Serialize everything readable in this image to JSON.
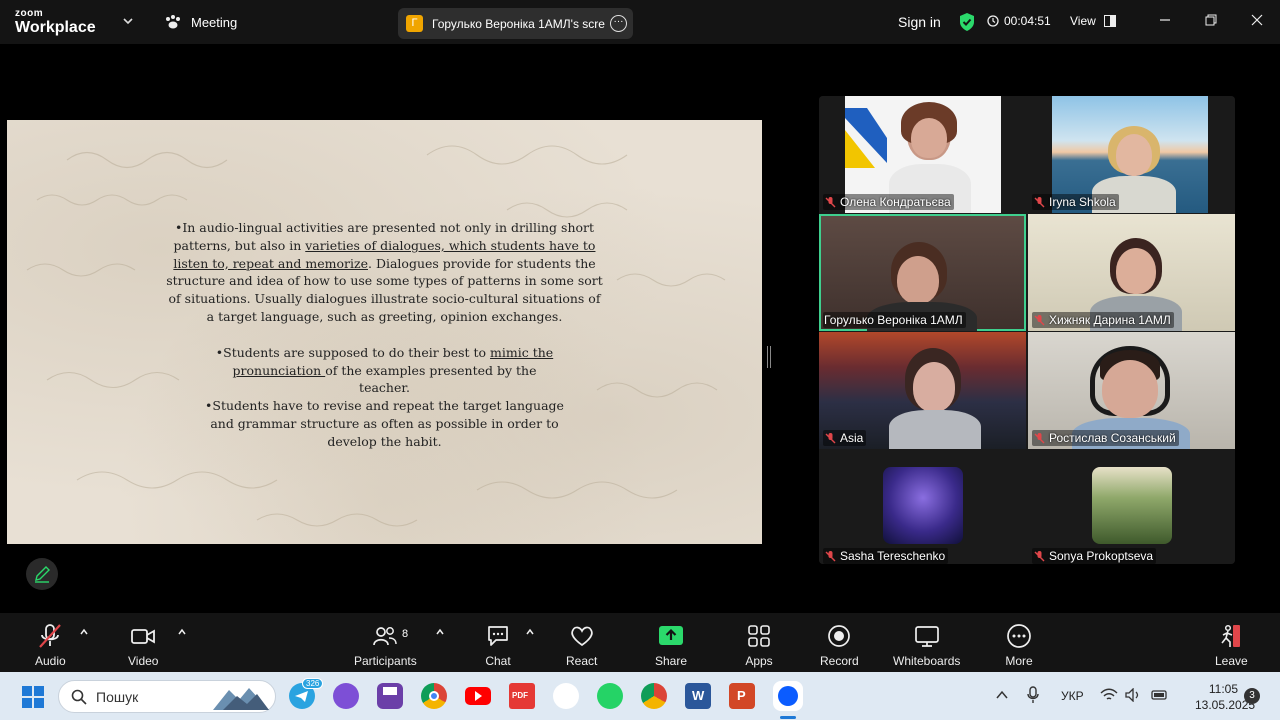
{
  "titlebar": {
    "logo_top": "zoom",
    "logo_bottom": "Workplace",
    "meeting_label": "Meeting",
    "share_initial": "Г",
    "share_title": "Горулько Вероніка 1АМЛ's scre",
    "signin_label": "Sign in",
    "timer": "00:04:51",
    "view_label": "View"
  },
  "slide": {
    "p1_a": "•In audio-lingual activities are presented not only in drilling short patterns, but also in ",
    "p1_u": "varieties of dialogues, which students have to listen to, repeat and memorize",
    "p1_b": ". Dialogues provide for students the structure and idea of how to use some types of patterns in some sort of situations. Usually dialogues illustrate socio-cultural situations of a target language, such as greeting, opinion exchanges.",
    "p2_a": "•Students are supposed to do their best to ",
    "p2_u": "mimic the pronunciation ",
    "p2_b": "of the examples presented by the teacher.",
    "p3": "•Students have to revise and repeat the target language and grammar structure as often as possible in order to develop the habit."
  },
  "participants": [
    {
      "name": "Олена  Кондратьєва"
    },
    {
      "name": "Iryna Shkola"
    },
    {
      "name": "Горулько Вероніка 1АМЛ"
    },
    {
      "name": "Хижняк Дарина 1АМЛ"
    },
    {
      "name": "Asia"
    },
    {
      "name": "Ростислав Созанський"
    },
    {
      "name": "Sasha Tereschenko"
    },
    {
      "name": "Sonya Prokoptseva"
    }
  ],
  "toolbar": {
    "audio": "Audio",
    "video": "Video",
    "participants": "Participants",
    "participants_count": "8",
    "chat": "Chat",
    "react": "React",
    "share": "Share",
    "apps": "Apps",
    "record": "Record",
    "whiteboards": "Whiteboards",
    "more": "More",
    "leave": "Leave"
  },
  "taskbar": {
    "search_placeholder": "Пошук",
    "telegram_badge": "326",
    "language": "УКР",
    "time": "11:05",
    "date": "13.05.2025",
    "notifications": "3"
  },
  "colors": {
    "active_speaker": "#3fcf8e",
    "share_green": "#2bd96b",
    "leave_red": "#e0464a",
    "muted_red": "#e0464a"
  }
}
